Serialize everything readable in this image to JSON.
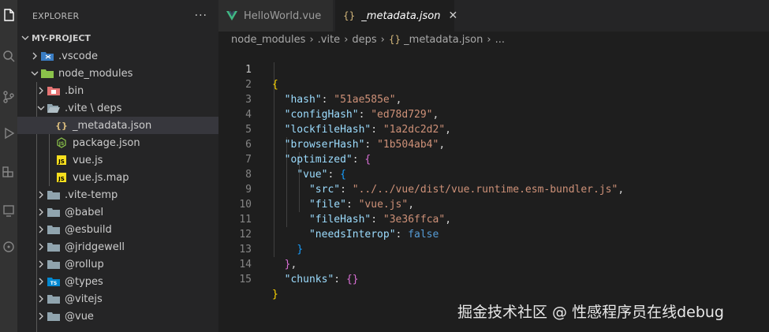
{
  "sidebar": {
    "title": "EXPLORER",
    "more": "···",
    "project": "MY-PROJECT",
    "items": [
      {
        "label": ".vscode",
        "icon": "vscode-folder-icon"
      },
      {
        "label": "node_modules",
        "icon": "node-folder-icon"
      },
      {
        "label": ".bin",
        "icon": "bin-folder-icon"
      },
      {
        "label": ".vite \\ deps",
        "icon": "folder-open-icon"
      },
      {
        "label": "_metadata.json",
        "icon": "json-icon"
      },
      {
        "label": "package.json",
        "icon": "package-json-icon"
      },
      {
        "label": "vue.js",
        "icon": "js-icon"
      },
      {
        "label": "vue.js.map",
        "icon": "js-map-icon"
      },
      {
        "label": ".vite-temp",
        "icon": "folder-icon"
      },
      {
        "label": "@babel",
        "icon": "folder-icon"
      },
      {
        "label": "@esbuild",
        "icon": "folder-icon"
      },
      {
        "label": "@jridgewell",
        "icon": "folder-icon"
      },
      {
        "label": "@rollup",
        "icon": "folder-icon"
      },
      {
        "label": "@types",
        "icon": "types-folder-icon"
      },
      {
        "label": "@vitejs",
        "icon": "folder-icon"
      },
      {
        "label": "@vue",
        "icon": "folder-icon"
      }
    ]
  },
  "tabs": [
    {
      "label": "HelloWorld.vue",
      "icon": "vue-icon",
      "active": false
    },
    {
      "label": "_metadata.json",
      "icon": "json-icon",
      "active": true
    }
  ],
  "breadcrumb": [
    "node_modules",
    ".vite",
    "deps",
    "_metadata.json",
    "..."
  ],
  "code": {
    "line_numbers": [
      "1",
      "2",
      "3",
      "4",
      "5",
      "6",
      "7",
      "8",
      "9",
      "10",
      "11",
      "12",
      "13",
      "14",
      "15"
    ],
    "tokens": {
      "l1_open": "{",
      "hash_key": "\"hash\"",
      "hash_val": "\"51ae585e\"",
      "confighash_key": "\"configHash\"",
      "confighash_val": "\"ed78d729\"",
      "lockfilehash_key": "\"lockfileHash\"",
      "lockfilehash_val": "\"1a2dc2d2\"",
      "browserhash_key": "\"browserHash\"",
      "browserhash_val": "\"1b504ab4\"",
      "optimized_key": "\"optimized\"",
      "optimized_open": "{",
      "vue_key": "\"vue\"",
      "vue_open": "{",
      "src_key": "\"src\"",
      "src_val": "\"../../vue/dist/vue.runtime.esm-bundler.js\"",
      "file_key": "\"file\"",
      "file_val": "\"vue.js\"",
      "filehash_key": "\"fileHash\"",
      "filehash_val": "\"3e36ffca\"",
      "needsinterop_key": "\"needsInterop\"",
      "needsinterop_val": "false",
      "vue_close": "}",
      "optimized_close": "}",
      "chunks_key": "\"chunks\"",
      "chunks_val": "{}",
      "l15_close": "}"
    }
  },
  "watermark": "掘金技术社区 @ 性感程序员在线debug",
  "colors": {
    "activity_bar": "#333333",
    "sidebar": "#252526",
    "editor": "#1e1e1e",
    "json_key": "#9cdcfe",
    "json_string": "#ce9178",
    "json_keyword": "#569cd6"
  }
}
